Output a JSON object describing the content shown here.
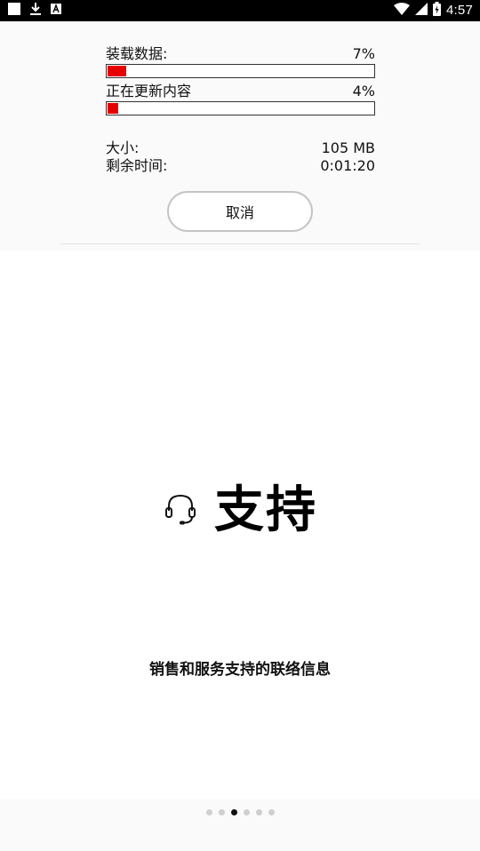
{
  "status_bar": {
    "time": "4:57",
    "icons": [
      "notification-square-icon",
      "download-icon",
      "a-badge-icon",
      "wifi-icon",
      "signal-icon",
      "battery-icon"
    ]
  },
  "update_panel": {
    "loading_label": "装载数据:",
    "loading_percent": "7%",
    "loading_progress": 0.07,
    "updating_label": "正在更新内容",
    "updating_percent": "4%",
    "updating_progress": 0.04,
    "size_label": "大小:",
    "size_value": "105 MB",
    "remaining_label": "剩余时间:",
    "remaining_value": "0:01:20",
    "cancel_label": "取消",
    "progress_color": "#e60000"
  },
  "feature": {
    "icon": "headset-icon",
    "title": "支持",
    "description": "销售和服务支持的联络信息"
  },
  "pager": {
    "count": 6,
    "active_index": 2
  }
}
